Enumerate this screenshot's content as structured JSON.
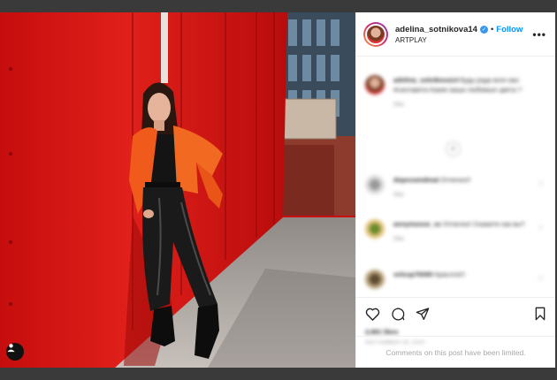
{
  "post": {
    "username": "adelina_sotnikova14",
    "location": "ARTPLAY",
    "follow_label": "Follow",
    "more_label": "•••",
    "separator": "•"
  },
  "comments": {
    "caption": {
      "username": "adelina_sotnikova14",
      "text": "Буду рада всех вас #сантавета Какие ваши любимые цвета ?",
      "time": "58w"
    },
    "items": [
      {
        "username": "dopesomdmat",
        "text": "Отлично!!",
        "time": "58w"
      },
      {
        "username": "annymoose_sc",
        "text": "Отлично! Скажите как вы?",
        "time": "58w"
      },
      {
        "username": "velsup76090",
        "text": "Красота!!!",
        "time": "58w"
      }
    ],
    "load_more_label": "+"
  },
  "actions": {
    "likes": "2,991 likes",
    "date": "SEPTEMBER 18, 2020",
    "comments_limited": "Comments on this post have been limited."
  },
  "colors": {
    "accent": "#0095f6",
    "wall_red": "#d41515",
    "jacket_orange": "#f05a1a"
  },
  "icons": [
    "heart-icon",
    "comment-icon",
    "share-icon",
    "bookmark-icon",
    "user-tag-icon",
    "verified-icon"
  ]
}
